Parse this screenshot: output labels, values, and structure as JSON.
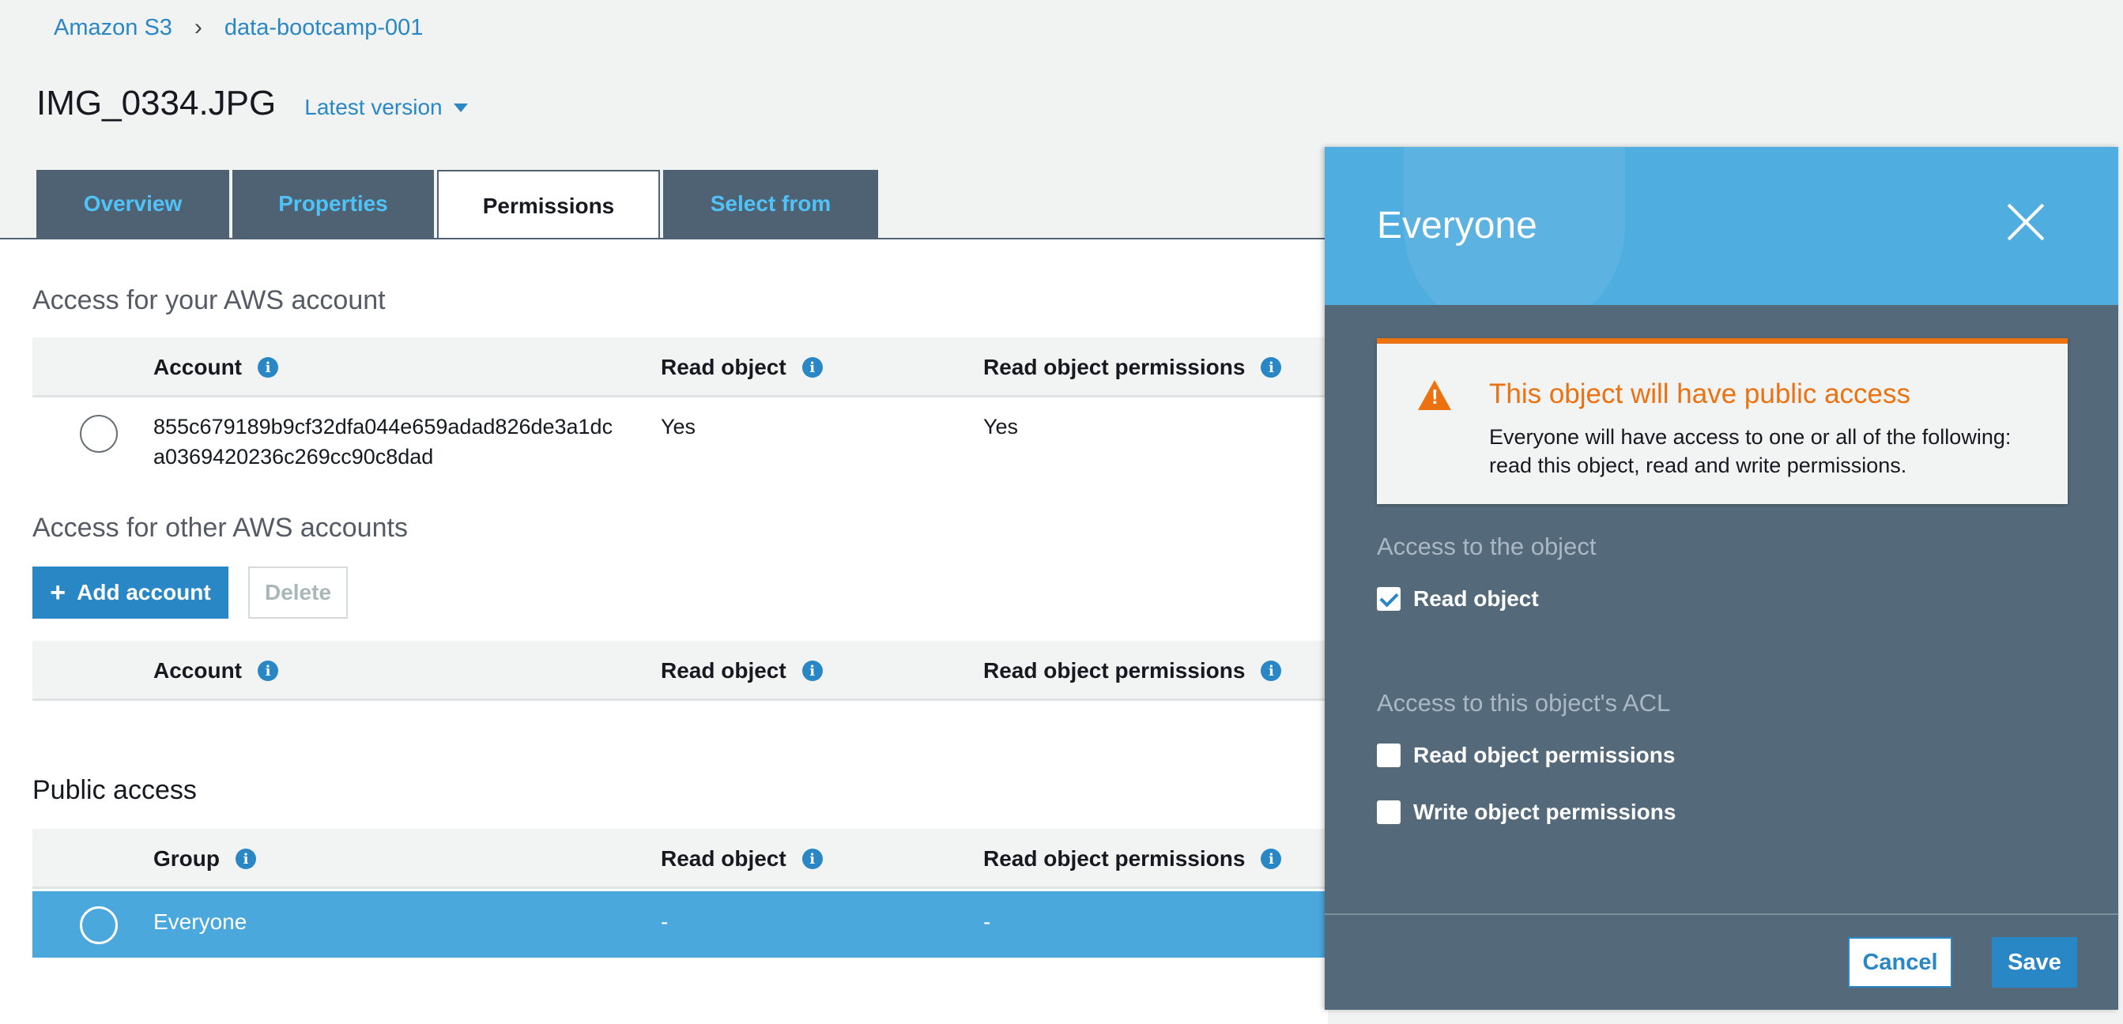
{
  "breadcrumb": {
    "root": "Amazon S3",
    "separator": "›",
    "bucket": "data-bootcamp-001"
  },
  "object": {
    "name": "IMG_0334.JPG",
    "version": "Latest version"
  },
  "tabs": [
    {
      "label": "Overview",
      "active": false
    },
    {
      "label": "Properties",
      "active": false
    },
    {
      "label": "Permissions",
      "active": true
    },
    {
      "label": "Select from",
      "active": false
    }
  ],
  "own_account": {
    "title": "Access for your AWS account",
    "headers": {
      "account": "Account",
      "read_object": "Read object",
      "read_perms": "Read object permissions"
    },
    "row": {
      "account_line1": "855c679189b9cf32dfa044e659adad826de3a1dc",
      "account_line2": "a0369420236c269cc90c8dad",
      "read_object": "Yes",
      "read_perms": "Yes"
    }
  },
  "other_accounts": {
    "title": "Access for other AWS accounts",
    "add_button": "Add account",
    "delete_button": "Delete",
    "headers": {
      "account": "Account",
      "read_object": "Read object",
      "read_perms": "Read object permissions"
    }
  },
  "public_access": {
    "title": "Public access",
    "headers": {
      "group": "Group",
      "read_object": "Read object",
      "read_perms": "Read object permissions"
    },
    "row": {
      "group": "Everyone",
      "read_object": "-",
      "read_perms": "-"
    }
  },
  "info_glyph": "i",
  "panel": {
    "title": "Everyone",
    "alert": {
      "title": "This object will have public access",
      "body": "Everyone will have access to one or all of the following: read this object, read and write permissions.",
      "icon_glyph": "!"
    },
    "object_section": "Access to the object",
    "read_object": {
      "label": "Read object",
      "checked": true
    },
    "acl_section": "Access to this object's ACL",
    "read_perms": {
      "label": "Read object permissions",
      "checked": false
    },
    "write_perms": {
      "label": "Write object permissions",
      "checked": false
    },
    "cancel": "Cancel",
    "save": "Save"
  },
  "colors": {
    "accent": "#2a87c5",
    "warning": "#ec7211",
    "panel_bg": "#546a7b",
    "selected_row": "#4aa8dc",
    "tab_bg": "#4e6274"
  }
}
